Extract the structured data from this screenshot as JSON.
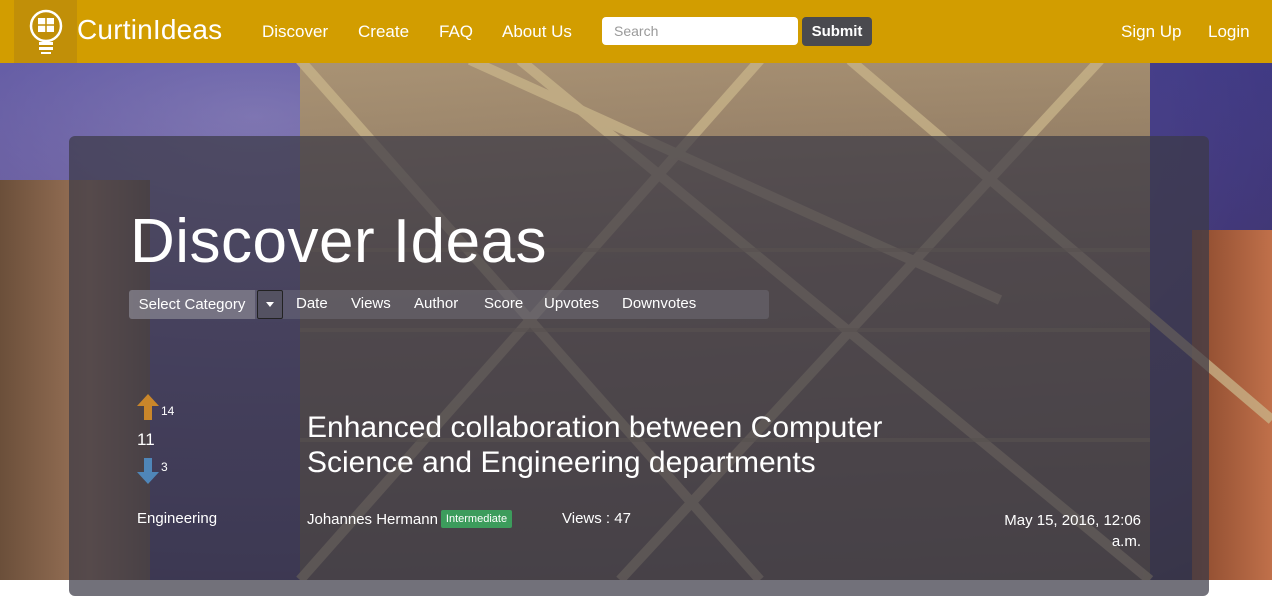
{
  "navbar": {
    "brand": "CurtinIdeas",
    "links": [
      "Discover",
      "Create",
      "FAQ",
      "About Us"
    ],
    "search_placeholder": "Search",
    "submit_label": "Submit",
    "signup_label": "Sign Up",
    "login_label": "Login",
    "color": "#d29d00"
  },
  "main": {
    "title": "Discover Ideas",
    "category_select": "Select Category",
    "sort_options": [
      "Date",
      "Views",
      "Author",
      "Score",
      "Upvotes",
      "Downvotes"
    ]
  },
  "ideas": [
    {
      "upvotes": "14",
      "score": "11",
      "downvotes": "3",
      "title": "Enhanced collaboration between Computer Science and Engineering departments",
      "category": "Engineering",
      "author": "Johannes Hermann",
      "level": "Intermediate",
      "views": "Views : 47",
      "date_line1": "May 15, 2016, 12:06",
      "date_line2": "a.m."
    }
  ],
  "icons": {
    "logo": "lightbulb-logo-icon",
    "up": "arrow-up-icon",
    "down": "arrow-down-icon",
    "caret": "caret-down-icon"
  }
}
